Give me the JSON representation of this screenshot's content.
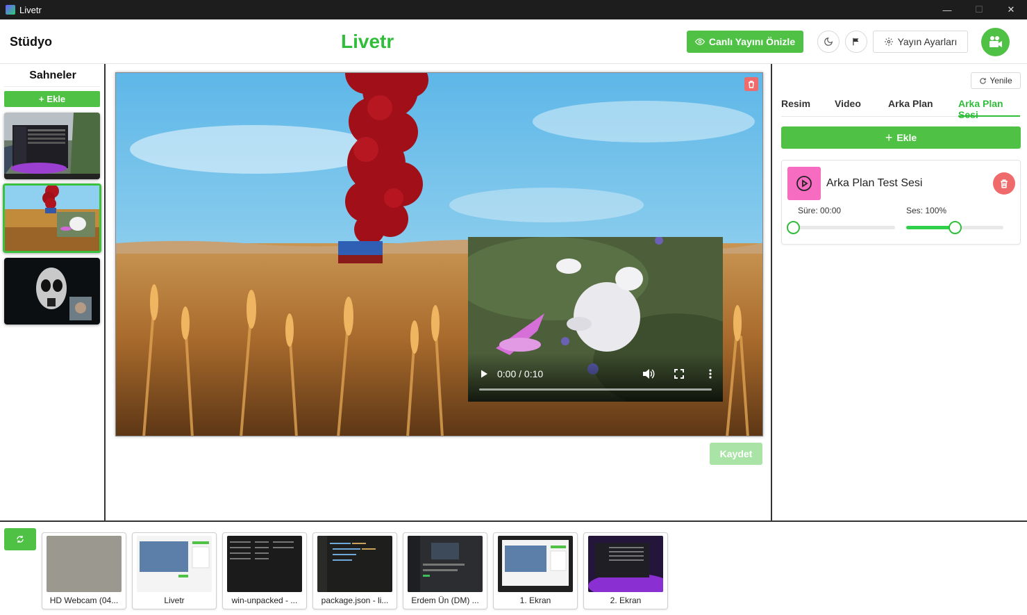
{
  "window": {
    "title": "Livetr"
  },
  "header": {
    "studio_label": "Stüdyo",
    "brand": "Livetr",
    "preview_button": "Canlı Yayını Önizle",
    "settings_button": "Yayın Ayarları"
  },
  "scenes": {
    "title": "Sahneler",
    "add_button": "Ekle",
    "items": [
      {
        "name": "desktop-scene",
        "active": false
      },
      {
        "name": "field-scene",
        "active": true
      },
      {
        "name": "ghost-scene",
        "active": false
      }
    ]
  },
  "stage": {
    "video": {
      "time": "0:00 / 0:10"
    },
    "save_button": "Kaydet"
  },
  "right_panel": {
    "refresh_button": "Yenile",
    "tabs": [
      {
        "label": "Resim",
        "active": false
      },
      {
        "label": "Video",
        "active": false
      },
      {
        "label": "Arka Plan",
        "active": false
      },
      {
        "label": "Arka Plan Sesi",
        "active": true
      }
    ],
    "add_button": "Ekle",
    "sound": {
      "name": "Arka Plan Test Sesi",
      "duration_label": "Süre: 00:00",
      "volume_label": "Ses: 100%",
      "duration_fraction": 0,
      "volume_fraction": 1.0
    }
  },
  "sources": [
    {
      "label": "HD Webcam (04..."
    },
    {
      "label": "Livetr"
    },
    {
      "label": "win-unpacked - ..."
    },
    {
      "label": "package.json - li..."
    },
    {
      "label": "Erdem Ün (DM) ..."
    },
    {
      "label": "1. Ekran"
    },
    {
      "label": "2. Ekran"
    }
  ],
  "colors": {
    "accent": "#4fc246",
    "brand_text": "#2fbd3a",
    "danger": "#ef6a6a",
    "sound_thumb": "#f56cc0"
  },
  "icons": {
    "preview": "eye-icon",
    "theme": "moon-icon",
    "flag": "flag-icon",
    "settings": "gear-icon",
    "camera": "video-camera-icon",
    "refresh": "refresh-icon",
    "delete": "trash-icon",
    "play": "play-icon",
    "add": "plus-icon"
  }
}
